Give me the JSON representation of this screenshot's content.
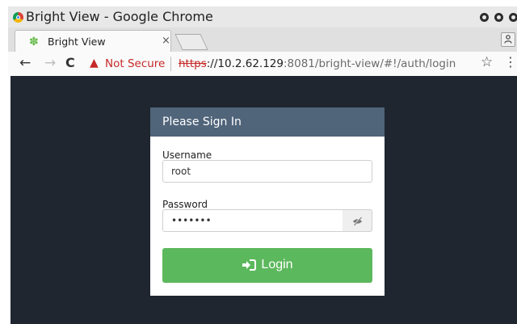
{
  "window": {
    "title": "Bright View - Google Chrome"
  },
  "tabs": [
    {
      "title": "Bright View",
      "close": "×"
    }
  ],
  "toolbar": {
    "back": "←",
    "forward": "→",
    "reload": "C",
    "security_label": "Not Secure",
    "url_scheme": "https",
    "url_host": "://10.2.62.129",
    "url_path": ":8081/bright-view/#!/auth/login",
    "bookmark_star": "☆",
    "menu": "⋮"
  },
  "signin": {
    "title": "Please Sign In",
    "username_label": "Username",
    "username_value": "root",
    "password_label": "Password",
    "password_value": "•••••••",
    "login_label": "Login"
  },
  "colors": {
    "header_bg": "#50647a",
    "page_bg": "#1f2630",
    "login_bg": "#5cb85c",
    "warning": "#c62828"
  },
  "icons": [
    "chrome-icon",
    "bright-view-favicon",
    "warning-icon",
    "star-icon",
    "menu-icon",
    "eye-slash-icon",
    "sign-in-icon",
    "profile-icon"
  ]
}
